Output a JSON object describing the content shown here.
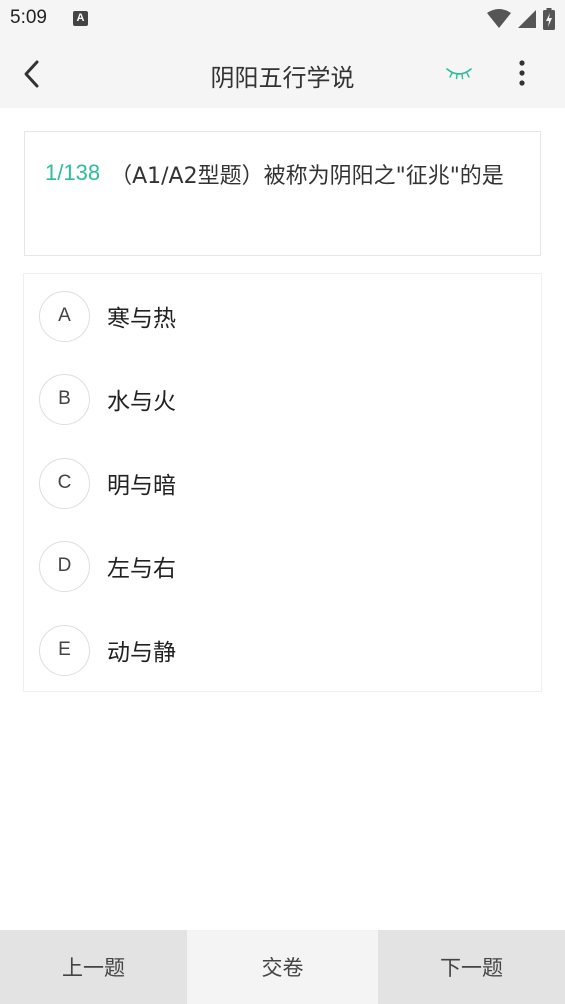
{
  "status_bar": {
    "time": "5:09",
    "app_icon_letter": "A"
  },
  "app_bar": {
    "title": "阴阳五行学说",
    "icons": {
      "back": "chevron-left-icon",
      "eye": "eye-closed-icon",
      "more": "more-vertical-icon"
    },
    "accent_color": "#2ebc9d"
  },
  "question": {
    "index": "1/138",
    "text": "（A1/A2型题）被称为阴阳之\"征兆\"的是"
  },
  "options": [
    {
      "letter": "A",
      "text": "寒与热"
    },
    {
      "letter": "B",
      "text": "水与火"
    },
    {
      "letter": "C",
      "text": "明与暗"
    },
    {
      "letter": "D",
      "text": "左与右"
    },
    {
      "letter": "E",
      "text": "动与静"
    }
  ],
  "bottom_bar": {
    "prev_label": "上一题",
    "submit_label": "交卷",
    "next_label": "下一题"
  }
}
